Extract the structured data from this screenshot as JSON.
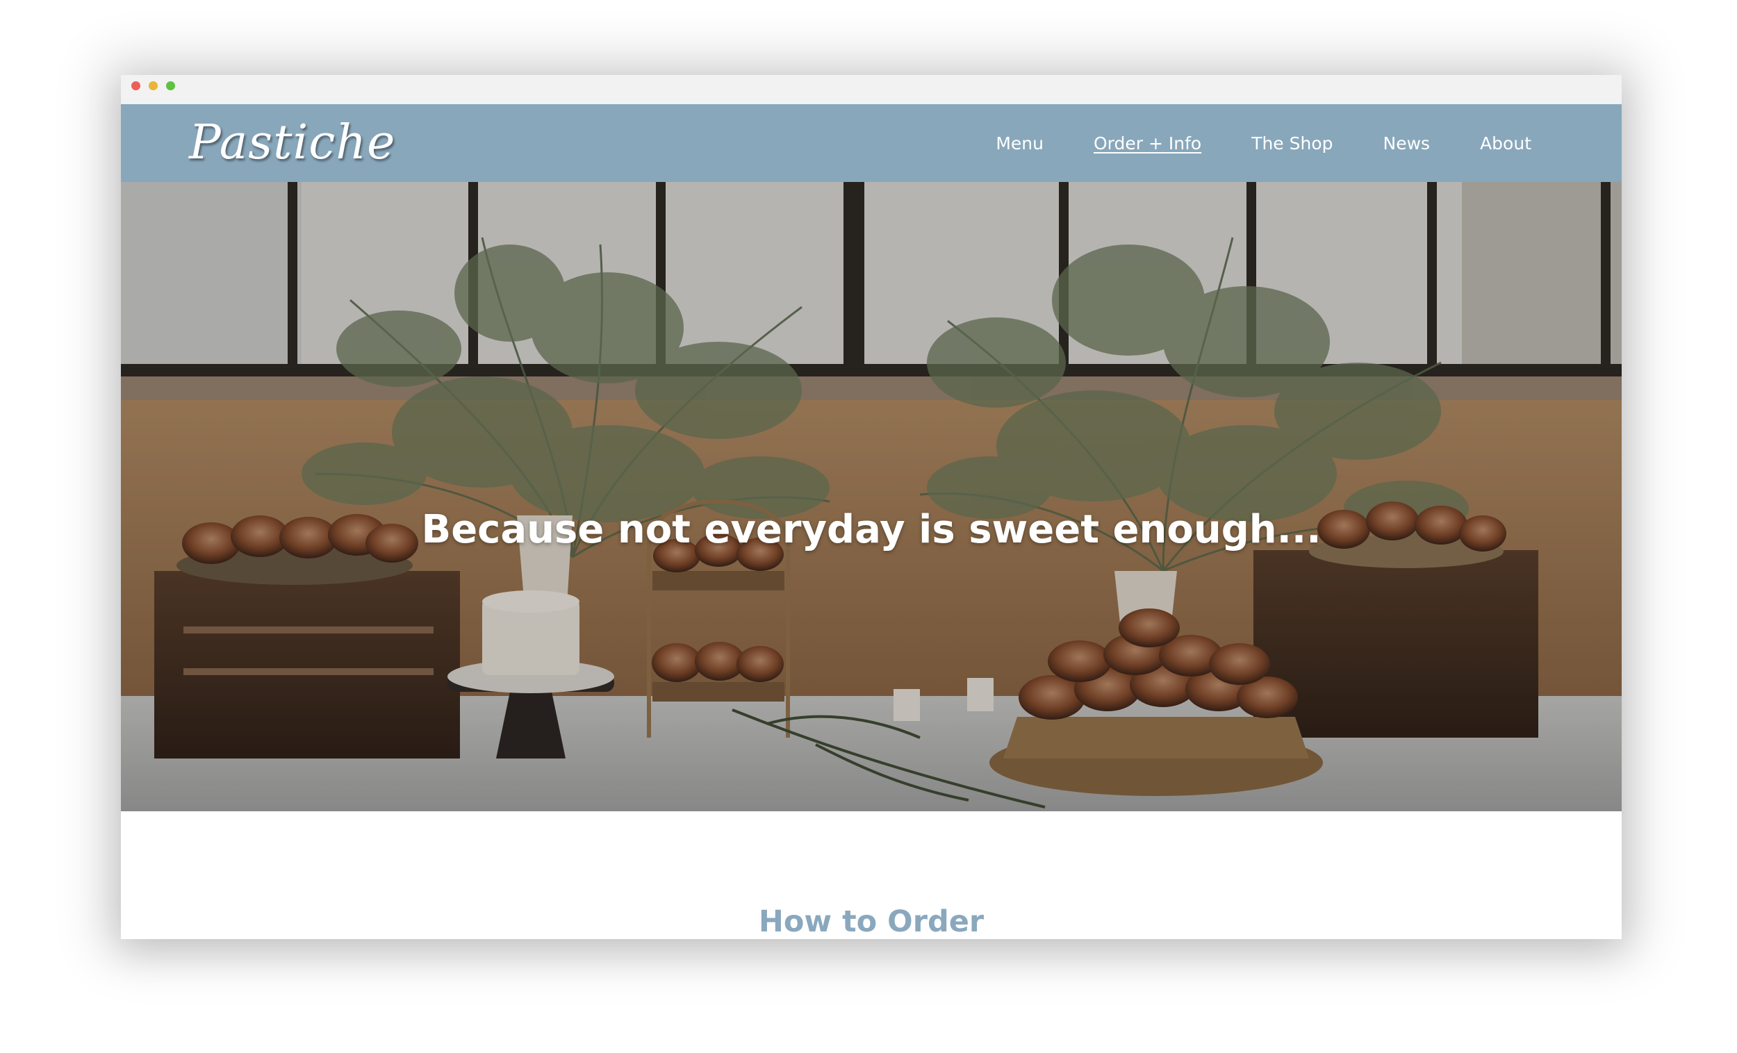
{
  "window": {
    "traffic_lights": {
      "close": "#ec5f57",
      "minimize": "#e9b43c",
      "maximize": "#5fc241"
    }
  },
  "header": {
    "logo_text": "Pastiche",
    "background_color": "#88a7bb",
    "nav": [
      {
        "label": "Menu",
        "active": false
      },
      {
        "label": "Order + Info",
        "active": true
      },
      {
        "label": "The Shop",
        "active": false
      },
      {
        "label": "News",
        "active": false
      },
      {
        "label": "About",
        "active": false
      }
    ]
  },
  "hero": {
    "tagline": "Because not everyday is sweet enough..."
  },
  "section": {
    "title": "How to Order",
    "title_color": "#8aa8bd"
  }
}
